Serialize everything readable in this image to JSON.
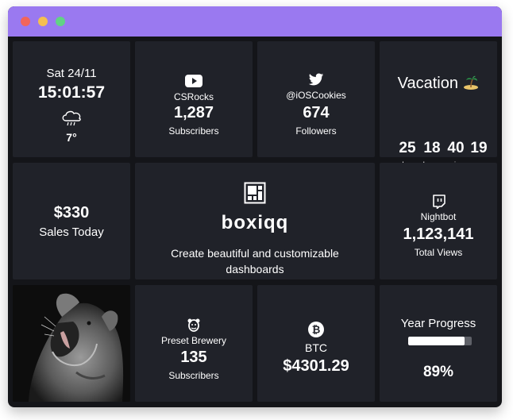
{
  "window": {
    "colors": {
      "titlebar": "#9a79f0",
      "background": "#141519",
      "tile": "#202229",
      "close": "#f2655a",
      "minimize": "#f5bf4f",
      "maximize": "#61d385"
    }
  },
  "clock": {
    "date": "Sat 24/11",
    "time": "15:01:57",
    "weather_icon": "rain-cloud-icon",
    "temperature": "7°"
  },
  "youtube": {
    "icon": "youtube-icon",
    "channel": "CSRocks",
    "count": "1,287",
    "label": "Subscribers"
  },
  "twitter": {
    "icon": "twitter-icon",
    "handle": "@iOSCookies",
    "count": "674",
    "label": "Followers"
  },
  "countdown": {
    "title": "Vacation",
    "icon": "island-emoji",
    "units": [
      {
        "value": "25",
        "label": "days"
      },
      {
        "value": "18",
        "label": "hours"
      },
      {
        "value": "40",
        "label": "mins"
      },
      {
        "value": "19",
        "label": "secs"
      }
    ]
  },
  "sales": {
    "amount": "$330",
    "label": "Sales Today"
  },
  "brand": {
    "logo": "boxiqq-logo-icon",
    "name": "boxiqq",
    "tagline_line1": "Create beautiful and customizable",
    "tagline_line2": "dashboards"
  },
  "twitch": {
    "icon": "twitch-icon",
    "channel": "Nightbot",
    "count": "1,123,141",
    "label": "Total Views"
  },
  "photo": {
    "subject": "roaring-lioness-photo"
  },
  "mailchimp": {
    "icon": "mailchimp-icon",
    "list": "Preset Brewery",
    "count": "135",
    "label": "Subscribers"
  },
  "btc": {
    "icon": "bitcoin-icon",
    "symbol": "BTC",
    "price": "$4301.29"
  },
  "year_progress": {
    "title": "Year Progress",
    "percent_label": "89%",
    "fraction": 0.89
  }
}
